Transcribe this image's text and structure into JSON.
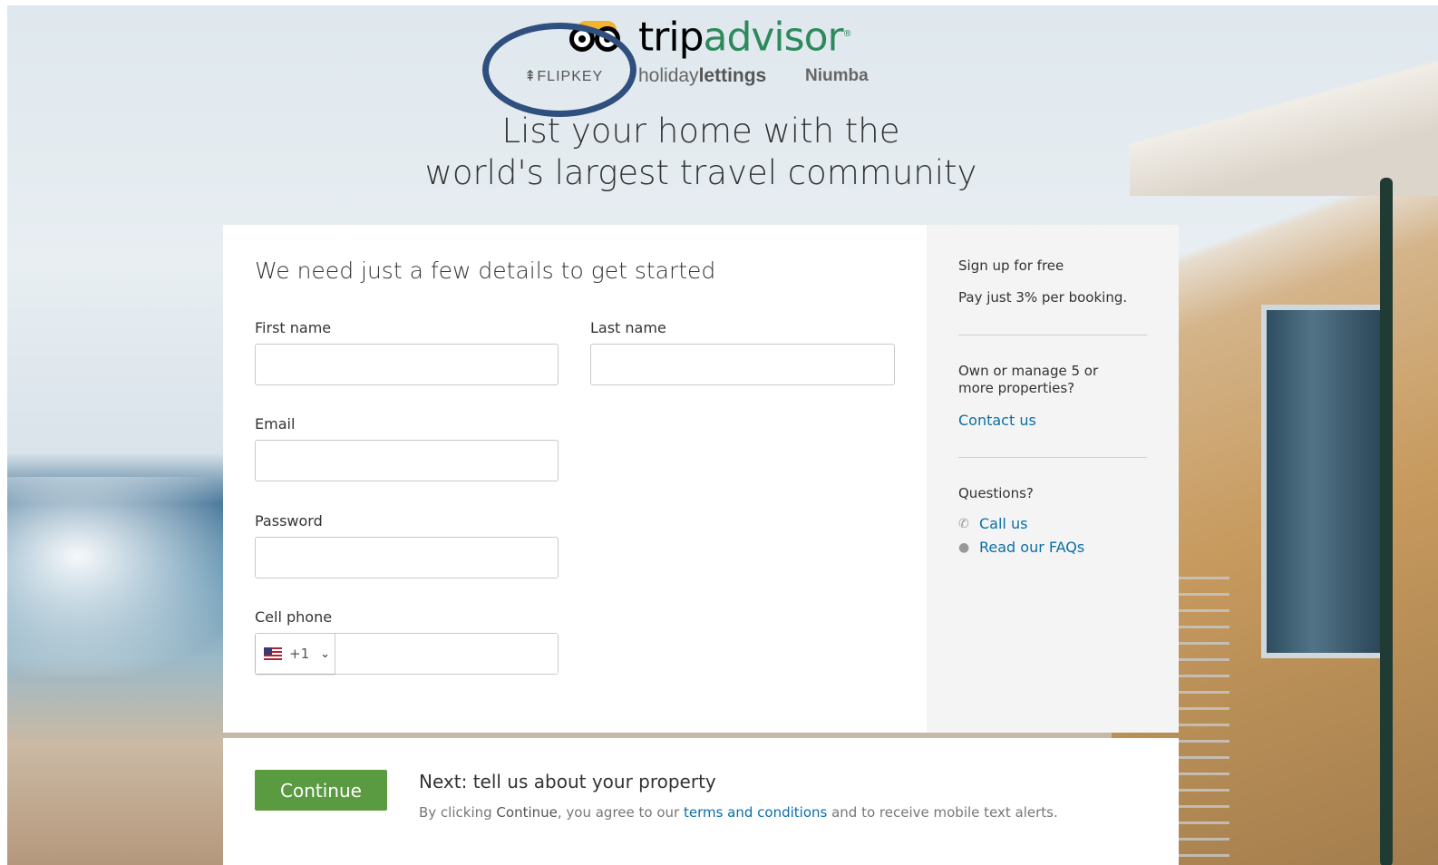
{
  "brand": {
    "logo_trip": "trip",
    "logo_advisor": "advisor",
    "logo_reg": "®",
    "flipkey": "⇞FLIPKEY",
    "holiday_light": "holiday",
    "holiday_bold": "lettings",
    "niumba": "Niumba"
  },
  "hero": {
    "line1": "List your home with the",
    "line2": "world's largest travel community"
  },
  "form": {
    "title": "We need just a few details to get started",
    "first_name_label": "First name",
    "last_name_label": "Last name",
    "email_label": "Email",
    "password_label": "Password",
    "cell_phone_label": "Cell phone",
    "first_name_value": "",
    "last_name_value": "",
    "email_value": "",
    "password_value": "",
    "phone_value": "",
    "country_code": "+1",
    "country_flag_icon": "us-flag-icon"
  },
  "sidebar": {
    "signup": "Sign up for free",
    "pricing": "Pay just 3% per booking.",
    "manage": "Own or manage 5 or more properties?",
    "contact_link": "Contact us",
    "questions": "Questions?",
    "call_link": "Call us",
    "faq_link": "Read our FAQs"
  },
  "footer": {
    "continue_label": "Continue",
    "next_title": "Next: tell us about your property",
    "legal_pre": "By clicking ",
    "legal_bold": "Continue",
    "legal_mid": ", you agree to our ",
    "legal_link": "terms and conditions",
    "legal_post": " and to receive mobile text alerts."
  },
  "colors": {
    "accent_green": "#5a9a40",
    "link_blue": "#0b6fa4",
    "ring": "#2f4f7e"
  }
}
